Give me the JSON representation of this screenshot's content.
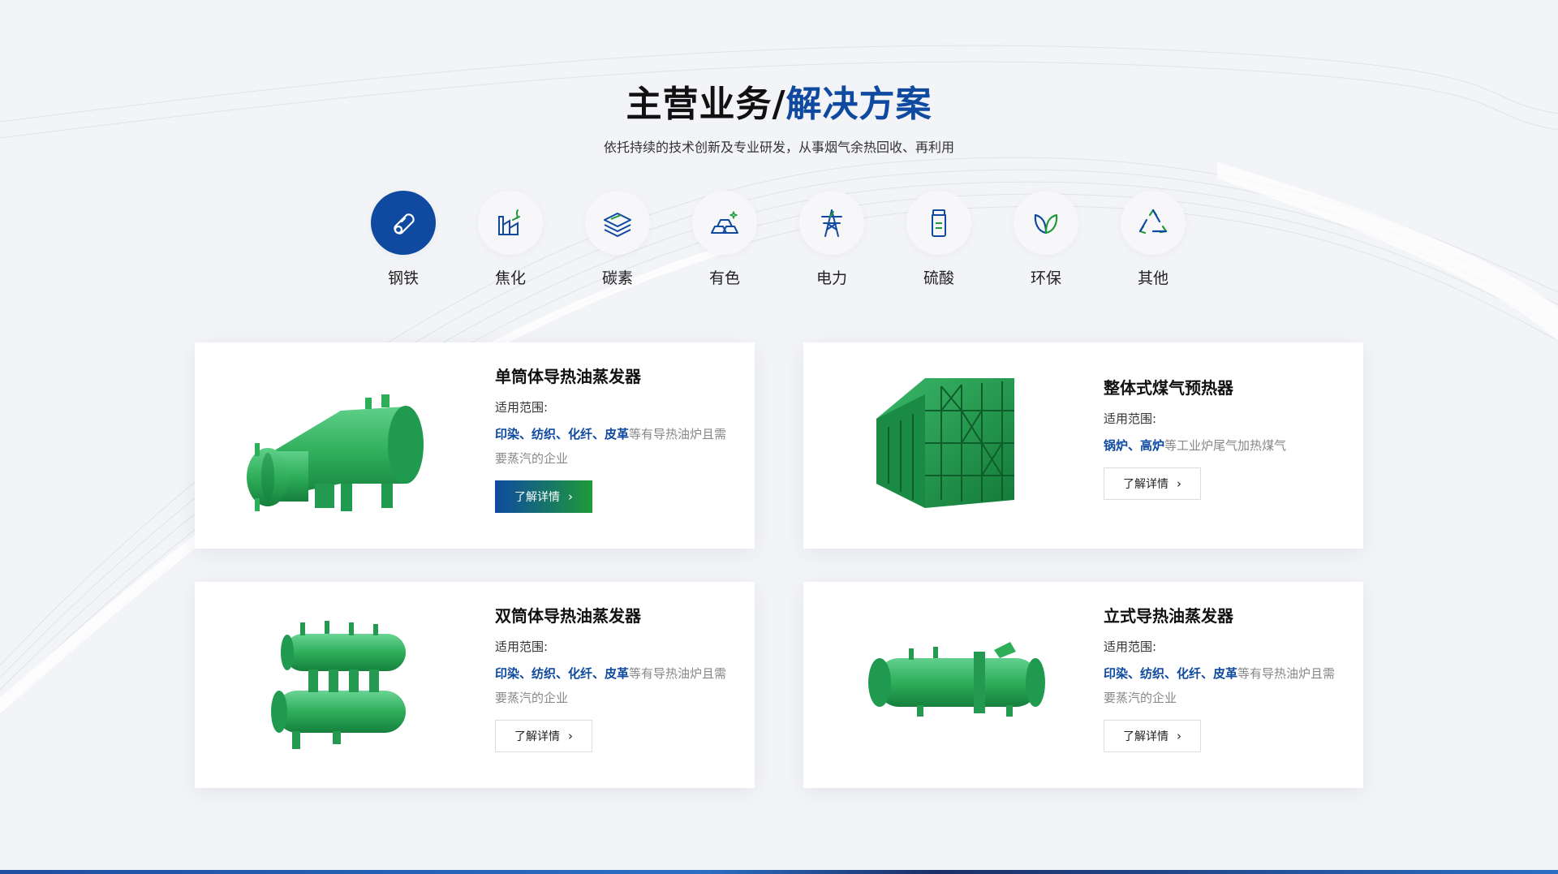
{
  "header": {
    "title_main": "主营业务/",
    "title_accent": "解决方案",
    "subtitle": "依托持续的技术创新及专业研发，从事烟气余热回收、再利用"
  },
  "categories": [
    {
      "label": "钢铁",
      "icon": "steel-pipe-icon",
      "active": true
    },
    {
      "label": "焦化",
      "icon": "factory-icon",
      "active": false
    },
    {
      "label": "碳素",
      "icon": "carbon-layers-icon",
      "active": false
    },
    {
      "label": "有色",
      "icon": "metal-ingots-icon",
      "active": false
    },
    {
      "label": "电力",
      "icon": "power-tower-icon",
      "active": false
    },
    {
      "label": "硫酸",
      "icon": "acid-bottle-icon",
      "active": false
    },
    {
      "label": "环保",
      "icon": "leaf-icon",
      "active": false
    },
    {
      "label": "其他",
      "icon": "recycle-icon",
      "active": false
    }
  ],
  "cards": [
    {
      "title": "单筒体导热油蒸发器",
      "scope_label": "适用范围:",
      "scope_highlight": "印染、纺织、化纤、皮革",
      "scope_rest": "等有导热油炉且需要蒸汽的企业",
      "button_label": "了解详情",
      "button_style": "primary"
    },
    {
      "title": "整体式煤气预热器",
      "scope_label": "适用范围:",
      "scope_highlight": "锅炉、高炉",
      "scope_rest": "等工业炉尾气加热煤气",
      "button_label": "了解详情",
      "button_style": "default"
    },
    {
      "title": "双筒体导热油蒸发器",
      "scope_label": "适用范围:",
      "scope_highlight": "印染、纺织、化纤、皮革",
      "scope_rest": "等有导热油炉且需要蒸汽的企业",
      "button_label": "了解详情",
      "button_style": "default"
    },
    {
      "title": "立式导热油蒸发器",
      "scope_label": "适用范围:",
      "scope_highlight": "印染、纺织、化纤、皮革",
      "scope_rest": "等有导热油炉且需要蒸汽的企业",
      "button_label": "了解详情",
      "button_style": "default"
    }
  ],
  "colors": {
    "brand_blue": "#0f4aa0",
    "brand_green": "#1f9a3a",
    "equipment_green": "#2fae5a"
  }
}
